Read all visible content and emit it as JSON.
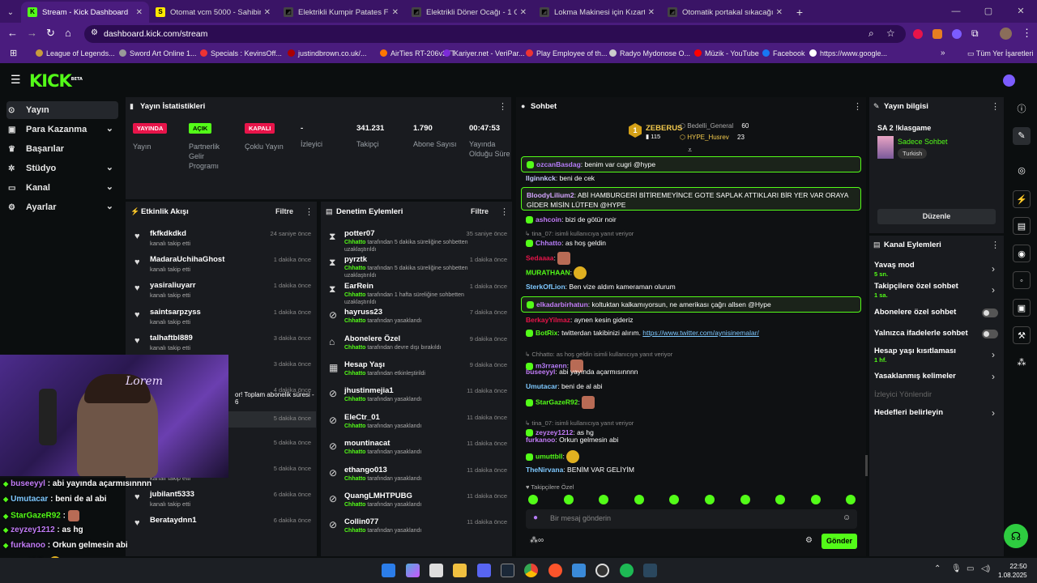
{
  "browser": {
    "tabs": [
      {
        "title": "Stream - Kick Dashboard",
        "color": "#53fc18",
        "glyph": "K",
        "active": true
      },
      {
        "title": "Otomat vcm 5000 - Sahibinden",
        "color": "#ffe800",
        "glyph": "S"
      },
      {
        "title": "Elektrikli Kumpir Patates Fırını -",
        "color": "#444",
        "glyph": "◩"
      },
      {
        "title": "Elektrikli Döner Ocağı - 1 Gözlü",
        "color": "#444",
        "glyph": "◩"
      },
      {
        "title": "Lokma Makinesi için Kızartma T",
        "color": "#444",
        "glyph": "◩"
      },
      {
        "title": "Otomatik portakal sıkacağı - Tu",
        "color": "#444",
        "glyph": "◩"
      }
    ],
    "url": "dashboard.kick.com/stream",
    "bookmarks": [
      "League of Legends...",
      "Sword Art Online 1...",
      "Specials : KevinsOff...",
      "justindbrown.co.uk/...",
      "AirTies RT-206v3TT",
      "Kariyer.net - VeriPar...",
      "Play Employee of th...",
      "Radyo Mydonose O...",
      "Müzik - YouTube",
      "Facebook",
      "https://www.google..."
    ],
    "bookmarks_all": "Tüm Yer İşaretleri"
  },
  "logo": "KICK",
  "logo_beta": "BETA",
  "sidebar": [
    {
      "label": "Yayın",
      "icon": "broadcast-icon"
    },
    {
      "label": "Para Kazanma",
      "icon": "dollar-icon"
    },
    {
      "label": "Başarılar",
      "icon": "trophy-icon"
    },
    {
      "label": "Stüdyo",
      "icon": "studio-icon"
    },
    {
      "label": "Kanal",
      "icon": "channel-icon"
    },
    {
      "label": "Ayarlar",
      "icon": "gear-icon"
    }
  ],
  "stats": {
    "title": "Yayın İstatistikleri",
    "badges": [
      {
        "badge": "YAYINDA",
        "label": "Yayın",
        "color": "#e8144a"
      },
      {
        "badge": "AÇIK",
        "label": "Partnerlik Gelir Programı",
        "color": "#53fc18"
      },
      {
        "badge": "KAPALI",
        "label": "Çoklu Yayın",
        "color": "#e8144a"
      }
    ],
    "values": [
      {
        "value": "-",
        "label": "İzleyici"
      },
      {
        "value": "341.231",
        "label": "Takipçi"
      },
      {
        "value": "1.790",
        "label": "Abone Sayısı"
      },
      {
        "value": "00:47:53",
        "label": "Yayında Olduğu Süre"
      }
    ]
  },
  "activity": {
    "title": "Etkinlik Akışı",
    "filter": "Filtre",
    "items": [
      {
        "name": "fkfkdkdkd",
        "desc": "kanalı takip etti",
        "time": "24 saniye önce"
      },
      {
        "name": "MadaraUchihaGhost",
        "desc": "kanalı takip etti",
        "time": "1 dakika önce"
      },
      {
        "name": "yasiraliuyarr",
        "desc": "kanalı takip etti",
        "time": "1 dakika önce"
      },
      {
        "name": "saintsarpzyss",
        "desc": "kanalı takip etti",
        "time": "1 dakika önce"
      },
      {
        "name": "talhaftbl889",
        "desc": "kanalı takip etti",
        "time": "3 dakika önce"
      },
      {
        "name": "",
        "desc": "",
        "time": "3 dakika önce"
      },
      {
        "name": "",
        "desc": "or! Toplam abonelik süresi - 6",
        "time": "4 dakika önce"
      },
      {
        "name": "",
        "desc": "",
        "time": "5 dakika önce"
      },
      {
        "name": "",
        "desc": "",
        "time": "5 dakika önce"
      },
      {
        "name": "sayloorxz",
        "desc": "kanalı takip etti",
        "time": "5 dakika önce"
      },
      {
        "name": "jubilant5333",
        "desc": "kanalı takip etti",
        "time": "6 dakika önce"
      },
      {
        "name": "Berataydnn1",
        "desc": "",
        "time": "6 dakika önce"
      }
    ]
  },
  "moderation": {
    "title": "Denetim Eylemleri",
    "filter": "Filtre",
    "items": [
      {
        "icon": "hourglass-icon",
        "name": "potter07",
        "who": "Chhatto",
        "desc": " tarafından 5 dakika süreliğine sohbetten uzaklaştırıldı",
        "time": "35 saniye önce"
      },
      {
        "icon": "hourglass-icon",
        "name": "pyrztk",
        "who": "Chhatto",
        "desc": " tarafından 5 dakika süreliğine sohbetten uzaklaştırıldı",
        "time": "1 dakika önce"
      },
      {
        "icon": "hourglass-icon",
        "name": "EarRein",
        "who": "Chhatto",
        "desc": " tarafından 1 hafta süreliğine sohbetten uzaklaştırıldı",
        "time": "1 dakika önce"
      },
      {
        "icon": "ban-icon",
        "name": "hayruss23",
        "who": "Chhatto",
        "desc": " tarafından yasaklandı",
        "time": "7 dakika önce"
      },
      {
        "icon": "gift-icon",
        "name": "Abonelere Özel",
        "who": "Chhatto",
        "desc": " tarafından devre dışı bırakıldı",
        "time": "9 dakika önce"
      },
      {
        "icon": "calendar-icon",
        "name": "Hesap Yaşı",
        "who": "Chhatto",
        "desc": " tarafından etkinleştirildi",
        "time": "9 dakika önce"
      },
      {
        "icon": "ban-icon",
        "name": "jhustinmejia1",
        "who": "Chhatto",
        "desc": " tarafından yasaklandı",
        "time": "11 dakika önce"
      },
      {
        "icon": "ban-icon",
        "name": "EleCtr_01",
        "who": "Chhatto",
        "desc": " tarafından yasaklandı",
        "time": "11 dakika önce"
      },
      {
        "icon": "ban-icon",
        "name": "mountinacat",
        "who": "Chhatto",
        "desc": " tarafından yasaklandı",
        "time": "11 dakika önce"
      },
      {
        "icon": "ban-icon",
        "name": "ethango013",
        "who": "Chhatto",
        "desc": " tarafından yasaklandı",
        "time": "11 dakika önce"
      },
      {
        "icon": "ban-icon",
        "name": "QuangLMHTPUBG",
        "who": "Chhatto",
        "desc": " tarafından yasaklandı",
        "time": "11 dakika önce"
      },
      {
        "icon": "ban-icon",
        "name": "Collin077",
        "who": "Chhatto",
        "desc": " tarafından yasaklandı",
        "time": "11 dakika önce"
      }
    ]
  },
  "chat": {
    "title": "Sohbet",
    "top": {
      "rank": "1",
      "name": "ZEBERUS",
      "count": "115",
      "others": [
        {
          "name": "Bedelli_General",
          "count": "60"
        },
        {
          "name": "HYPE_Husrev",
          "count": "23"
        }
      ]
    },
    "messages": [
      {
        "user": "ozcanBasdag",
        "color": "#b57cf7",
        "text": "benim var cugri @hype",
        "hl": true
      },
      {
        "user": "Ilginnkck",
        "color": "#c7c7ff",
        "text": "beni de cek"
      },
      {
        "user": "BloodyLilium2",
        "color": "#d4a5ff",
        "text": "ABİ HAMBURGERİ BİTİREMEYİNCE GOTE SAPLAK ATTIKLARI BİR YER VAR ORAYA GİDER MİSİN LÜTFEN @HYPE",
        "hl": true
      },
      {
        "user": "ashcoin",
        "color": "#c27cf7",
        "text": "bizi de götür noir"
      },
      {
        "user": "Chhatto",
        "color": "#b57cf7",
        "text": "as hoş geldin",
        "reply": "tina_07: isimli kullanıcıya yanıt veriyor"
      },
      {
        "user": "Sedaaaa",
        "color": "#e8144a",
        "text": ""
      },
      {
        "user": "MURATHAAN",
        "color": "#53fc18",
        "text": ""
      },
      {
        "user": "SterkOfLion",
        "color": "#7ec8ff",
        "text": "Ben vize aldım kameraman olurum"
      },
      {
        "user": "elkadarbirhatun",
        "color": "#c27cf7",
        "text": "koltuktan kalkamıyorsun, ne amerikası çağrı allsen @Hype",
        "hl": true
      },
      {
        "user": "BerkayYilmaz",
        "color": "#e8144a",
        "text": "aynen kesin gideriz"
      },
      {
        "user": "BotRix",
        "color": "#53fc18",
        "text": "twitterdan takibinizi alırım.",
        "link": "https://www.twitter.com/aynisinemalar/"
      },
      {
        "user": "m3rraenn",
        "color": "#b57cf7",
        "text": "",
        "reply": "Chhatto: as hoş geldin isimli kullanıcıya yanıt veriyor"
      },
      {
        "user": "buseeyyl",
        "color": "#c27cf7",
        "text": "abi yayında açarmısınnnn"
      },
      {
        "user": "Umutacar",
        "color": "#7ec8ff",
        "text": "beni de al abi"
      },
      {
        "user": "StarGazeR92",
        "color": "#53fc18",
        "text": ""
      },
      {
        "user": "zeyzey1212",
        "color": "#c27cf7",
        "text": "as hg",
        "reply": "tina_07: isimli kullanıcıya yanıt veriyor"
      },
      {
        "user": "furkanoo",
        "color": "#c27cf7",
        "text": "Orkun gelmesin abi"
      },
      {
        "user": "umuttbll",
        "color": "#53fc18",
        "text": ""
      },
      {
        "user": "TheNirvana",
        "color": "#7ec8ff",
        "text": "BENİM VAR GELİYİM"
      }
    ],
    "followers_only": "Takipçilere Özel",
    "placeholder": "Bir mesaj gönderin",
    "send": "Gönder"
  },
  "info": {
    "title": "Yayın bilgisi",
    "stream_title": "SA 2 !klasgame",
    "category": "Sadece Sohbet",
    "tag": "Turkish",
    "edit": "Düzenle"
  },
  "channel_actions": {
    "title": "Kanal Eylemleri",
    "items": [
      {
        "label": "Yavaş mod",
        "sub": "5 sn.",
        "type": "chevron"
      },
      {
        "label": "Takipçilere özel sohbet",
        "sub": "1 sa.",
        "type": "chevron"
      },
      {
        "label": "Abonelere özel sohbet",
        "sub": "",
        "type": "toggle"
      },
      {
        "label": "Yalnızca ifadelerle sohbet",
        "sub": "",
        "type": "toggle"
      },
      {
        "label": "Hesap yaşı kısıtlaması",
        "sub": "1 hf.",
        "type": "chevron"
      },
      {
        "label": "Yasaklanmış kelimeler",
        "sub": "",
        "type": "chevron"
      },
      {
        "label": "İzleyici Yönlendir",
        "sub": "",
        "type": "disabled"
      },
      {
        "label": "Hedefleri belirleyin",
        "sub": "",
        "type": "chevron"
      }
    ]
  },
  "overlay_chat": [
    {
      "user": "buseeyyl",
      "color": "#c27cf7",
      "text": "abi yayında açarmısınnnn"
    },
    {
      "user": "Umutacar",
      "color": "#7ec8ff",
      "text": "beni de al abi"
    },
    {
      "user": "StarGazeR92",
      "color": "#53fc18",
      "text": ""
    },
    {
      "user": "zeyzey1212",
      "color": "#c27cf7",
      "text": "as hg"
    },
    {
      "user": "furkanoo",
      "color": "#c27cf7",
      "text": "Orkun gelmesin abi"
    },
    {
      "user": "umuttbll",
      "color": "#53fc18",
      "text": ""
    }
  ],
  "taskbar": {
    "time": "22:50",
    "date": "1.08.2025"
  }
}
